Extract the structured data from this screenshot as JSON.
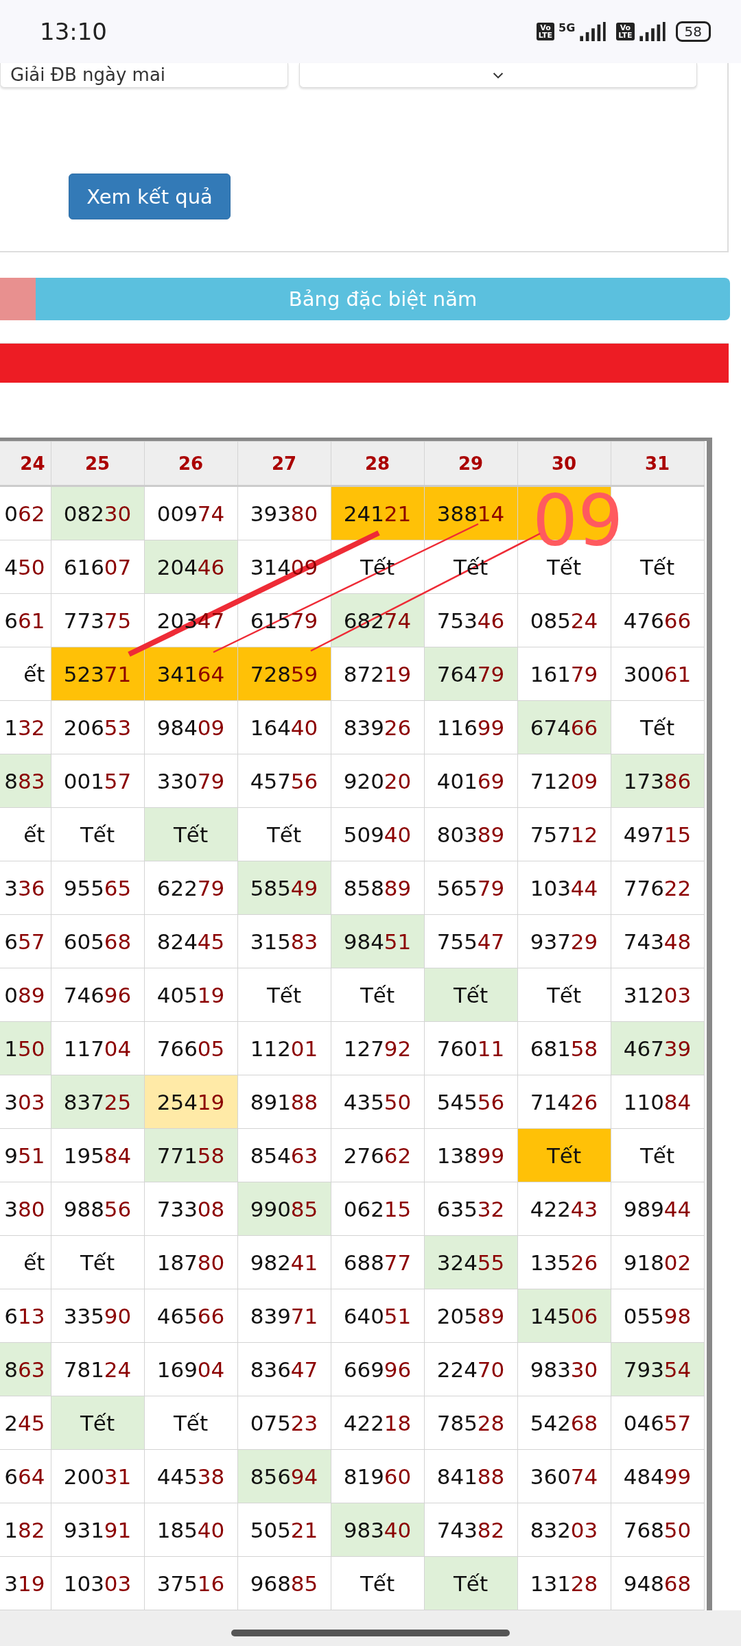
{
  "status_bar": {
    "time": "13:10",
    "badges": [
      {
        "top": "Vo",
        "bottom": "LTE"
      },
      {
        "top": "Vo",
        "bottom": "LTE"
      }
    ],
    "network": "5G",
    "battery": "58"
  },
  "form": {
    "left_field": "Giải ĐB ngày mai",
    "submit": "Xem kết quả"
  },
  "tabs": [
    {
      "selected": false
    },
    {
      "label": "Bảng đặc biệt năm",
      "selected": true
    }
  ],
  "table": {
    "columns": [
      "24",
      "25",
      "26",
      "27",
      "28",
      "29",
      "30",
      "31"
    ],
    "annotation": "09",
    "rows": [
      [
        {
          "head": "0",
          "tail": "62"
        },
        {
          "head": "082",
          "tail": "30",
          "color": "#dff0d8"
        },
        {
          "head": "009",
          "tail": "74"
        },
        {
          "head": "393",
          "tail": "80"
        },
        {
          "head": "241",
          "tail": "21",
          "color": "#ffc107"
        },
        {
          "head": "388",
          "tail": "14",
          "color": "#ffc107"
        },
        {
          "color": "#ffc107"
        },
        {}
      ],
      [
        {
          "head": "4",
          "tail": "50"
        },
        {
          "head": "616",
          "tail": "07"
        },
        {
          "head": "204",
          "tail": "46",
          "color": "#dff0d8"
        },
        {
          "head": "314",
          "tail": "09"
        },
        {
          "head": "Tết"
        },
        {
          "head": "Tết"
        },
        {
          "head": "Tết"
        },
        {
          "head": "Tết"
        }
      ],
      [
        {
          "head": "6",
          "tail": "61"
        },
        {
          "head": "773",
          "tail": "75"
        },
        {
          "head": "203",
          "tail": "47"
        },
        {
          "head": "615",
          "tail": "79"
        },
        {
          "head": "682",
          "tail": "74",
          "color": "#dff0d8"
        },
        {
          "head": "753",
          "tail": "46"
        },
        {
          "head": "085",
          "tail": "24"
        },
        {
          "head": "476",
          "tail": "66"
        }
      ],
      [
        {
          "head": "ết"
        },
        {
          "head": "523",
          "tail": "71",
          "color": "#ffc107"
        },
        {
          "head": "341",
          "tail": "64",
          "color": "#ffc107"
        },
        {
          "head": "728",
          "tail": "59",
          "color": "#ffc107"
        },
        {
          "head": "872",
          "tail": "19"
        },
        {
          "head": "764",
          "tail": "79",
          "color": "#dff0d8"
        },
        {
          "head": "161",
          "tail": "79"
        },
        {
          "head": "300",
          "tail": "61"
        }
      ],
      [
        {
          "head": "1",
          "tail": "32"
        },
        {
          "head": "206",
          "tail": "53"
        },
        {
          "head": "984",
          "tail": "09"
        },
        {
          "head": "164",
          "tail": "40"
        },
        {
          "head": "839",
          "tail": "26"
        },
        {
          "head": "116",
          "tail": "99"
        },
        {
          "head": "674",
          "tail": "66",
          "color": "#dff0d8"
        },
        {
          "head": "Tết"
        }
      ],
      [
        {
          "head": "8",
          "tail": "83",
          "color": "#dff0d8"
        },
        {
          "head": "001",
          "tail": "57"
        },
        {
          "head": "330",
          "tail": "79"
        },
        {
          "head": "457",
          "tail": "56"
        },
        {
          "head": "920",
          "tail": "20"
        },
        {
          "head": "401",
          "tail": "69"
        },
        {
          "head": "712",
          "tail": "09"
        },
        {
          "head": "173",
          "tail": "86",
          "color": "#dff0d8"
        }
      ],
      [
        {
          "head": "ết"
        },
        {
          "head": "Tết"
        },
        {
          "head": "Tết",
          "color": "#dff0d8"
        },
        {
          "head": "Tết"
        },
        {
          "head": "509",
          "tail": "40"
        },
        {
          "head": "803",
          "tail": "89"
        },
        {
          "head": "757",
          "tail": "12"
        },
        {
          "head": "497",
          "tail": "15"
        }
      ],
      [
        {
          "head": "3",
          "tail": "36"
        },
        {
          "head": "955",
          "tail": "65"
        },
        {
          "head": "622",
          "tail": "79"
        },
        {
          "head": "585",
          "tail": "49",
          "color": "#dff0d8"
        },
        {
          "head": "858",
          "tail": "89"
        },
        {
          "head": "565",
          "tail": "79"
        },
        {
          "head": "103",
          "tail": "44"
        },
        {
          "head": "776",
          "tail": "22"
        }
      ],
      [
        {
          "head": "6",
          "tail": "57"
        },
        {
          "head": "605",
          "tail": "68"
        },
        {
          "head": "824",
          "tail": "45"
        },
        {
          "head": "315",
          "tail": "83"
        },
        {
          "head": "984",
          "tail": "51",
          "color": "#dff0d8"
        },
        {
          "head": "755",
          "tail": "47"
        },
        {
          "head": "937",
          "tail": "29"
        },
        {
          "head": "743",
          "tail": "48"
        }
      ],
      [
        {
          "head": "0",
          "tail": "89"
        },
        {
          "head": "746",
          "tail": "96"
        },
        {
          "head": "405",
          "tail": "19"
        },
        {
          "head": "Tết"
        },
        {
          "head": "Tết"
        },
        {
          "head": "Tết",
          "color": "#dff0d8"
        },
        {
          "head": "Tết"
        },
        {
          "head": "312",
          "tail": "03"
        }
      ],
      [
        {
          "head": "1",
          "tail": "50",
          "color": "#dff0d8"
        },
        {
          "head": "117",
          "tail": "04"
        },
        {
          "head": "766",
          "tail": "05"
        },
        {
          "head": "112",
          "tail": "01"
        },
        {
          "head": "127",
          "tail": "92"
        },
        {
          "head": "760",
          "tail": "11"
        },
        {
          "head": "681",
          "tail": "58"
        },
        {
          "head": "467",
          "tail": "39",
          "color": "#dff0d8"
        }
      ],
      [
        {
          "head": "3",
          "tail": "03"
        },
        {
          "head": "837",
          "tail": "25",
          "color": "#dff0d8"
        },
        {
          "head": "254",
          "tail": "19",
          "color": "#ffeaa7"
        },
        {
          "head": "891",
          "tail": "88"
        },
        {
          "head": "435",
          "tail": "50"
        },
        {
          "head": "545",
          "tail": "56"
        },
        {
          "head": "714",
          "tail": "26"
        },
        {
          "head": "110",
          "tail": "84"
        }
      ],
      [
        {
          "head": "9",
          "tail": "51"
        },
        {
          "head": "195",
          "tail": "84"
        },
        {
          "head": "771",
          "tail": "58",
          "color": "#dff0d8"
        },
        {
          "head": "854",
          "tail": "63"
        },
        {
          "head": "276",
          "tail": "62"
        },
        {
          "head": "138",
          "tail": "99"
        },
        {
          "head": "Tết",
          "color": "#ffc107"
        },
        {
          "head": "Tết"
        }
      ],
      [
        {
          "head": "3",
          "tail": "80"
        },
        {
          "head": "988",
          "tail": "56"
        },
        {
          "head": "733",
          "tail": "08"
        },
        {
          "head": "990",
          "tail": "85",
          "color": "#dff0d8"
        },
        {
          "head": "062",
          "tail": "15"
        },
        {
          "head": "635",
          "tail": "32"
        },
        {
          "head": "422",
          "tail": "43"
        },
        {
          "head": "989",
          "tail": "44"
        }
      ],
      [
        {
          "head": "ết"
        },
        {
          "head": "Tết"
        },
        {
          "head": "187",
          "tail": "80"
        },
        {
          "head": "982",
          "tail": "41"
        },
        {
          "head": "688",
          "tail": "77"
        },
        {
          "head": "324",
          "tail": "55",
          "color": "#dff0d8"
        },
        {
          "head": "135",
          "tail": "26"
        },
        {
          "head": "918",
          "tail": "02"
        }
      ],
      [
        {
          "head": "6",
          "tail": "13"
        },
        {
          "head": "335",
          "tail": "90"
        },
        {
          "head": "465",
          "tail": "66"
        },
        {
          "head": "839",
          "tail": "71"
        },
        {
          "head": "640",
          "tail": "51"
        },
        {
          "head": "205",
          "tail": "89"
        },
        {
          "head": "145",
          "tail": "06",
          "color": "#dff0d8"
        },
        {
          "head": "055",
          "tail": "98"
        }
      ],
      [
        {
          "head": "8",
          "tail": "63",
          "color": "#dff0d8"
        },
        {
          "head": "781",
          "tail": "24"
        },
        {
          "head": "169",
          "tail": "04"
        },
        {
          "head": "836",
          "tail": "47"
        },
        {
          "head": "669",
          "tail": "96"
        },
        {
          "head": "224",
          "tail": "70"
        },
        {
          "head": "983",
          "tail": "30"
        },
        {
          "head": "793",
          "tail": "54",
          "color": "#dff0d8"
        }
      ],
      [
        {
          "head": "2",
          "tail": "45"
        },
        {
          "head": "Tết",
          "color": "#dff0d8"
        },
        {
          "head": "Tết"
        },
        {
          "head": "075",
          "tail": "23"
        },
        {
          "head": "422",
          "tail": "18"
        },
        {
          "head": "785",
          "tail": "28"
        },
        {
          "head": "542",
          "tail": "68"
        },
        {
          "head": "046",
          "tail": "57"
        }
      ],
      [
        {
          "head": "6",
          "tail": "64"
        },
        {
          "head": "200",
          "tail": "31"
        },
        {
          "head": "445",
          "tail": "38"
        },
        {
          "head": "856",
          "tail": "94",
          "color": "#dff0d8"
        },
        {
          "head": "819",
          "tail": "60"
        },
        {
          "head": "841",
          "tail": "88"
        },
        {
          "head": "360",
          "tail": "74"
        },
        {
          "head": "484",
          "tail": "99"
        }
      ],
      [
        {
          "head": "1",
          "tail": "82"
        },
        {
          "head": "931",
          "tail": "91"
        },
        {
          "head": "185",
          "tail": "40"
        },
        {
          "head": "505",
          "tail": "21"
        },
        {
          "head": "983",
          "tail": "40",
          "color": "#dff0d8"
        },
        {
          "head": "743",
          "tail": "82"
        },
        {
          "head": "832",
          "tail": "03"
        },
        {
          "head": "768",
          "tail": "50"
        }
      ],
      [
        {
          "head": "3",
          "tail": "19"
        },
        {
          "head": "103",
          "tail": "03"
        },
        {
          "head": "375",
          "tail": "16"
        },
        {
          "head": "968",
          "tail": "85"
        },
        {
          "head": "Tết"
        },
        {
          "head": "Tết",
          "color": "#dff0d8"
        },
        {
          "head": "131",
          "tail": "28"
        },
        {
          "head": "948",
          "tail": "68"
        }
      ]
    ]
  }
}
